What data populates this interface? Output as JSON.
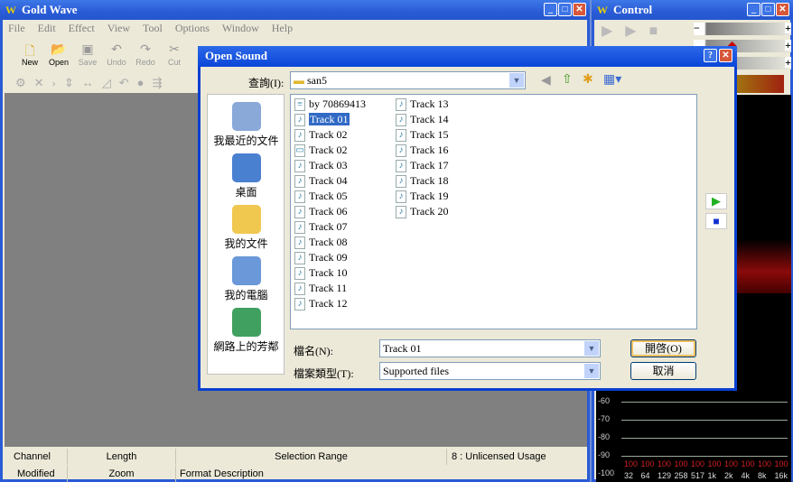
{
  "main_window": {
    "title": "Gold Wave",
    "logo": "W",
    "menu": [
      "File",
      "Edit",
      "Effect",
      "View",
      "Tool",
      "Options",
      "Window",
      "Help"
    ],
    "toolbar": [
      {
        "label": "New",
        "icon": "new-file-icon",
        "enabled": true
      },
      {
        "label": "Open",
        "icon": "open-folder-icon",
        "enabled": true
      },
      {
        "label": "Save",
        "icon": "save-icon",
        "enabled": false
      },
      {
        "label": "Undo",
        "icon": "undo-icon",
        "enabled": false
      },
      {
        "label": "Redo",
        "icon": "redo-icon",
        "enabled": false
      },
      {
        "label": "Cut",
        "icon": "cut-icon",
        "enabled": false
      }
    ],
    "status": {
      "channel": "Channel",
      "length": "Length",
      "selection": "Selection Range",
      "usage": "8 : Unlicensed Usage",
      "modified": "Modified",
      "zoom": "Zoom",
      "format": "Format Description"
    }
  },
  "control_window": {
    "title": "Control",
    "logo": "W",
    "spectrum": {
      "y_labels": [
        "-60",
        "-70",
        "-80",
        "-90",
        "-100"
      ],
      "x_labels": [
        "32",
        "64",
        "129",
        "258",
        "517",
        "1k",
        "2k",
        "4k",
        "8k",
        "16k"
      ],
      "band_values": [
        "100",
        "100",
        "100",
        "100",
        "100",
        "100",
        "100",
        "100",
        "100",
        "100"
      ]
    }
  },
  "dialog": {
    "title": "Open Sound",
    "look_in_label": "查詢(I):",
    "look_in_value": "san5",
    "places": [
      "我最近的文件",
      "桌面",
      "我的文件",
      "我的電腦",
      "網路上的芳鄰"
    ],
    "files_col1": [
      {
        "name": "by 70869413",
        "type": "text"
      },
      {
        "name": "Track 01",
        "type": "audio",
        "selected": true
      },
      {
        "name": "Track 02",
        "type": "audio"
      },
      {
        "name": "Track 02",
        "type": "playlist"
      },
      {
        "name": "Track 03",
        "type": "audio"
      },
      {
        "name": "Track 04",
        "type": "audio"
      },
      {
        "name": "Track 05",
        "type": "audio"
      },
      {
        "name": "Track 06",
        "type": "audio"
      },
      {
        "name": "Track 07",
        "type": "audio"
      },
      {
        "name": "Track 08",
        "type": "audio"
      },
      {
        "name": "Track 09",
        "type": "audio"
      },
      {
        "name": "Track 10",
        "type": "audio"
      },
      {
        "name": "Track 11",
        "type": "audio"
      },
      {
        "name": "Track 12",
        "type": "audio"
      }
    ],
    "files_col2": [
      {
        "name": "Track 13"
      },
      {
        "name": "Track 14"
      },
      {
        "name": "Track 15"
      },
      {
        "name": "Track 16"
      },
      {
        "name": "Track 17"
      },
      {
        "name": "Track 18"
      },
      {
        "name": "Track 19"
      },
      {
        "name": "Track 20"
      }
    ],
    "filename_label": "檔名(N):",
    "filename_value": "Track 01",
    "filetype_label": "檔案類型(T):",
    "filetype_value": "Supported files",
    "open_button": "開啓(O)",
    "cancel_button": "取消"
  },
  "colors": {
    "title_blue": "#2a5bd6",
    "selection": "#316ac5",
    "play_green": "#20b020",
    "stop_blue": "#1030d0"
  }
}
